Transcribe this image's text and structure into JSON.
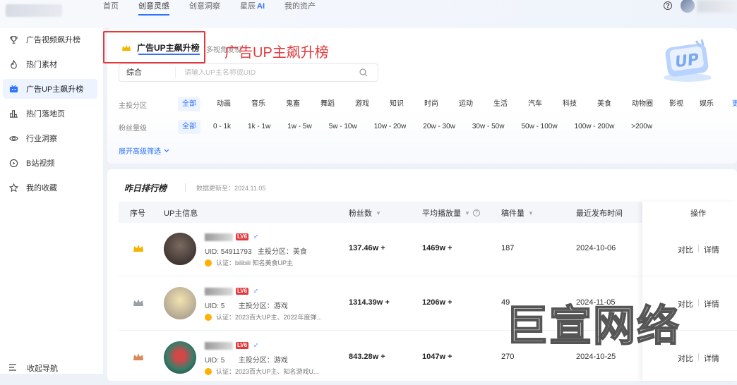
{
  "topnav": {
    "items": [
      {
        "label": "首页",
        "active": false
      },
      {
        "label": "创意灵感",
        "active": true
      },
      {
        "label": "创意洞察",
        "active": false
      },
      {
        "label": "星辰",
        "ai": "AI",
        "active": false
      },
      {
        "label": "我的资产",
        "active": false
      }
    ],
    "help": "?"
  },
  "sidebar": {
    "items": [
      {
        "label": "广告视频飙升榜",
        "icon": "trophy-icon"
      },
      {
        "label": "热门素材",
        "icon": "flame-icon"
      },
      {
        "label": "广告UP主飙升榜",
        "icon": "tv-icon",
        "active": true
      },
      {
        "label": "热门落地页",
        "icon": "bar-chart-icon"
      },
      {
        "label": "行业洞察",
        "icon": "eye-icon"
      },
      {
        "label": "B站视频",
        "icon": "play-circle-icon"
      },
      {
        "label": "我的收藏",
        "icon": "star-icon"
      }
    ],
    "footer": "收起导航"
  },
  "tab": {
    "title": "广告UP主飙升榜",
    "sub": "多视角发现"
  },
  "annotation": "广告UP主飙升榜",
  "search": {
    "category": "综合",
    "placeholder": "请输入UP主名称或UID"
  },
  "filters": {
    "category_label": "主投分区",
    "categories": [
      "全部",
      "动画",
      "音乐",
      "鬼畜",
      "舞蹈",
      "游戏",
      "知识",
      "时尚",
      "运动",
      "生活",
      "汽车",
      "科技",
      "美食",
      "动物圈",
      "影视",
      "娱乐"
    ],
    "categories_more": "更多",
    "fans_label": "粉丝量级",
    "fans": [
      "全部",
      "0 - 1k",
      "1k - 1w",
      "1w - 5w",
      "5w - 10w",
      "10w - 20w",
      "20w - 30w",
      "30w - 50w",
      "50w - 100w",
      "100w - 200w",
      ">200w"
    ],
    "expand": "展开高级筛选"
  },
  "ranking": {
    "title": "昨日排行榜",
    "updated": "数据更新至：2024.11.05",
    "columns": {
      "rank": "序号",
      "up_info": "UP主信息",
      "fans": "粉丝数",
      "avg_play": "平均播放量",
      "works": "稿件量",
      "last_post": "最近发布时间",
      "actions": "操作"
    },
    "rows": [
      {
        "level": "LV6",
        "uid": "UID: 54911793",
        "zone": "主投分区：美食",
        "cert": "认证：bilibili 知名美食UP主",
        "fans": "137.46w +",
        "avg_play": "1469w +",
        "works": "187",
        "last_post": "2024-10-06",
        "compare": "对比",
        "detail": "详情",
        "crown_color": "#f5b400"
      },
      {
        "level": "LV6",
        "uid": "UID: 5",
        "zone": "主投分区：游戏",
        "cert": "认证：2023百大UP主、2022年度弹...",
        "fans": "1314.39w +",
        "avg_play": "1206w +",
        "works": "49",
        "last_post": "2024-11-05",
        "compare": "对比",
        "detail": "详情",
        "crown_color": "#9aa0a8"
      },
      {
        "level": "LV6",
        "uid": "UID: 5",
        "zone": "主投分区：游戏",
        "cert": "认证：2023百大UP主、知名游戏U...",
        "fans": "843.28w +",
        "avg_play": "1047w +",
        "works": "270",
        "last_post": "2024-10-25",
        "compare": "对比",
        "detail": "详情",
        "crown_color": "#d98a5a"
      }
    ]
  },
  "watermark": "巨宣网络"
}
